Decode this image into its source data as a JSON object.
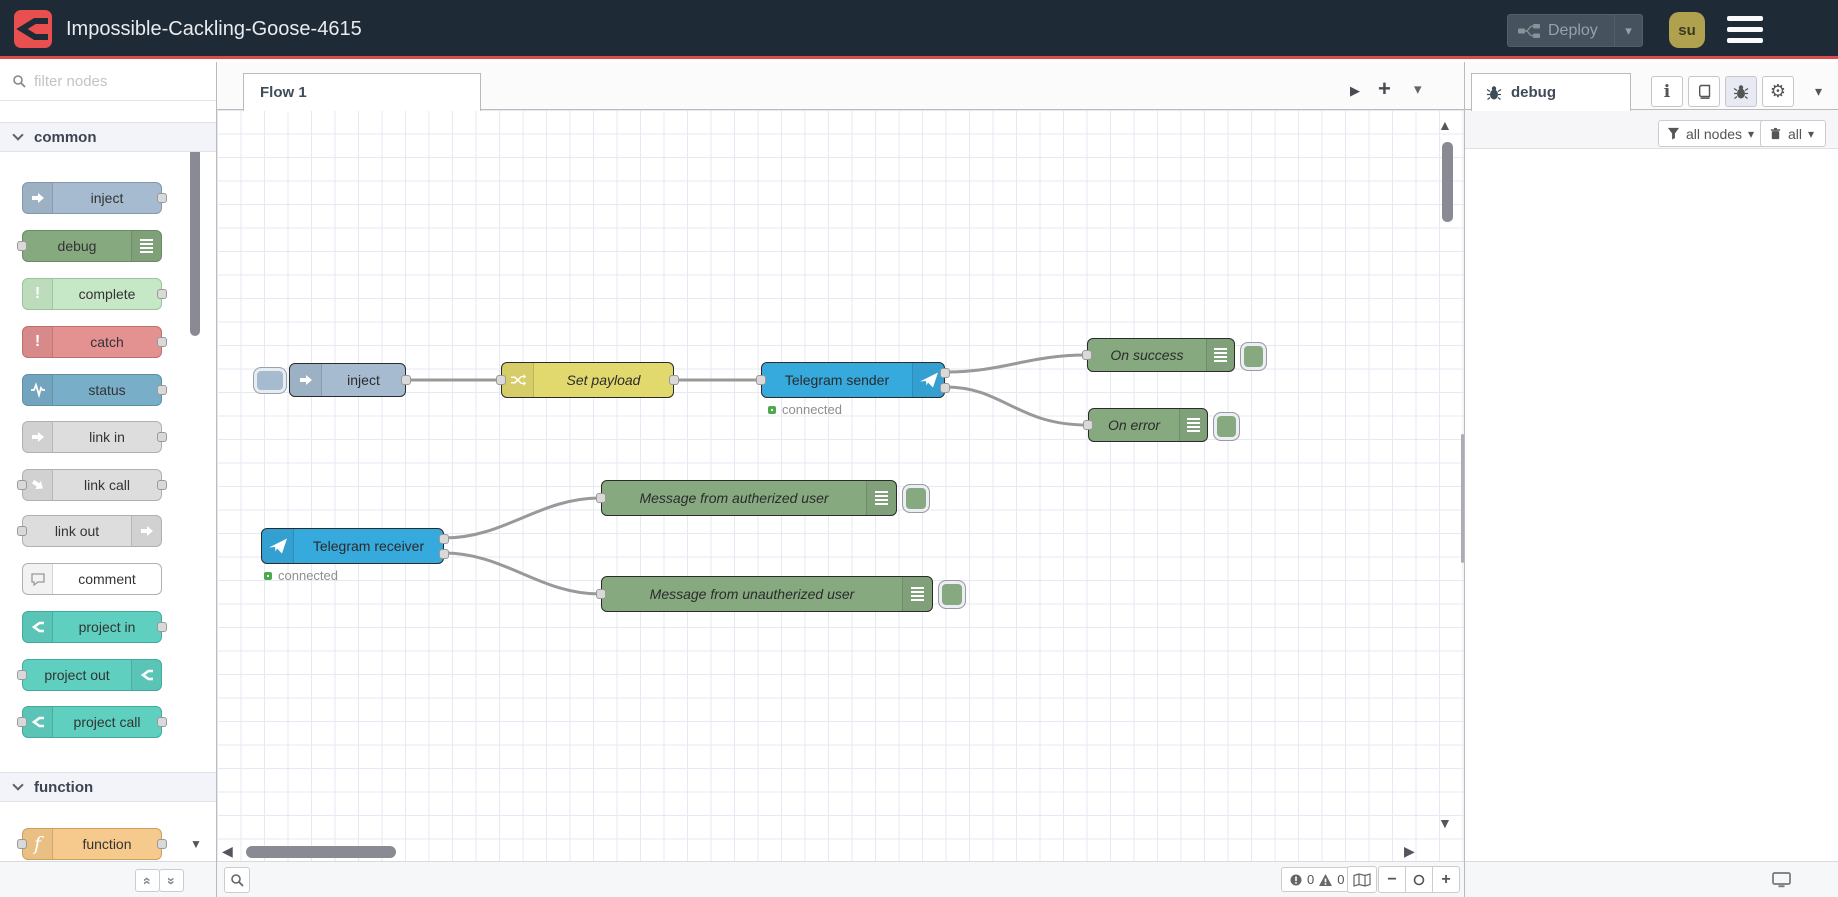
{
  "header": {
    "title": "Impossible-Cackling-Goose-4615",
    "deploy_label": "Deploy",
    "avatar_initials": "su"
  },
  "palette": {
    "filter_placeholder": "filter nodes",
    "categories": [
      {
        "label": "common",
        "items": [
          {
            "label": "inject"
          },
          {
            "label": "debug"
          },
          {
            "label": "complete"
          },
          {
            "label": "catch"
          },
          {
            "label": "status"
          },
          {
            "label": "link in"
          },
          {
            "label": "link call"
          },
          {
            "label": "link out"
          },
          {
            "label": "comment"
          },
          {
            "label": "project in"
          },
          {
            "label": "project out"
          },
          {
            "label": "project call"
          }
        ]
      },
      {
        "label": "function",
        "items": [
          {
            "label": "function"
          }
        ]
      }
    ]
  },
  "workspace": {
    "tab_label": "Flow 1",
    "nodes": {
      "inject": {
        "label": "inject"
      },
      "set_payload": {
        "label": "Set payload"
      },
      "telegram_sender": {
        "label": "Telegram sender",
        "status": "connected"
      },
      "on_success": {
        "label": "On success"
      },
      "on_error": {
        "label": "On error"
      },
      "telegram_receiver": {
        "label": "Telegram receiver",
        "status": "connected"
      },
      "msg_authorized": {
        "label": "Message from autherized user"
      },
      "msg_unauthorized": {
        "label": "Message from unautherized user"
      }
    },
    "footer": {
      "error_count": "0",
      "warning_count": "0"
    }
  },
  "sidebar": {
    "tab_label": "debug",
    "filter_label": "all nodes",
    "clear_label": "all"
  },
  "icons": {
    "caret_down": "▾",
    "tri_left": "◀",
    "tri_right": "▶",
    "tri_up": "▲",
    "tri_down": "▼",
    "plus": "+",
    "minus": "−",
    "gear": "⚙",
    "collapse_up": "«",
    "collapse_down": "»",
    "exclamation": "!",
    "function_f": "f",
    "info": "i"
  },
  "colors": {
    "header_bg": "#1f2a37",
    "accent_red": "#dd4b4b",
    "logo_red": "#ea4f4f",
    "deploy_bg": "#46525e",
    "avatar_bg": "#b0a14f",
    "node_inject": "#a6bbcf",
    "node_debug": "#87a980",
    "node_complete": "#c7e8c7",
    "node_catch": "#e49191",
    "node_status": "#79aec8",
    "node_link": "#dddddd",
    "node_comment": "#ffffff",
    "node_project": "#5fd0c0",
    "node_function": "#f6ca8c",
    "node_change": "#e2d96e",
    "node_telegram": "#36a9dd",
    "status_connected": "#4ca94c",
    "wire": "#999999",
    "grid_line": "#e6e8f4"
  }
}
